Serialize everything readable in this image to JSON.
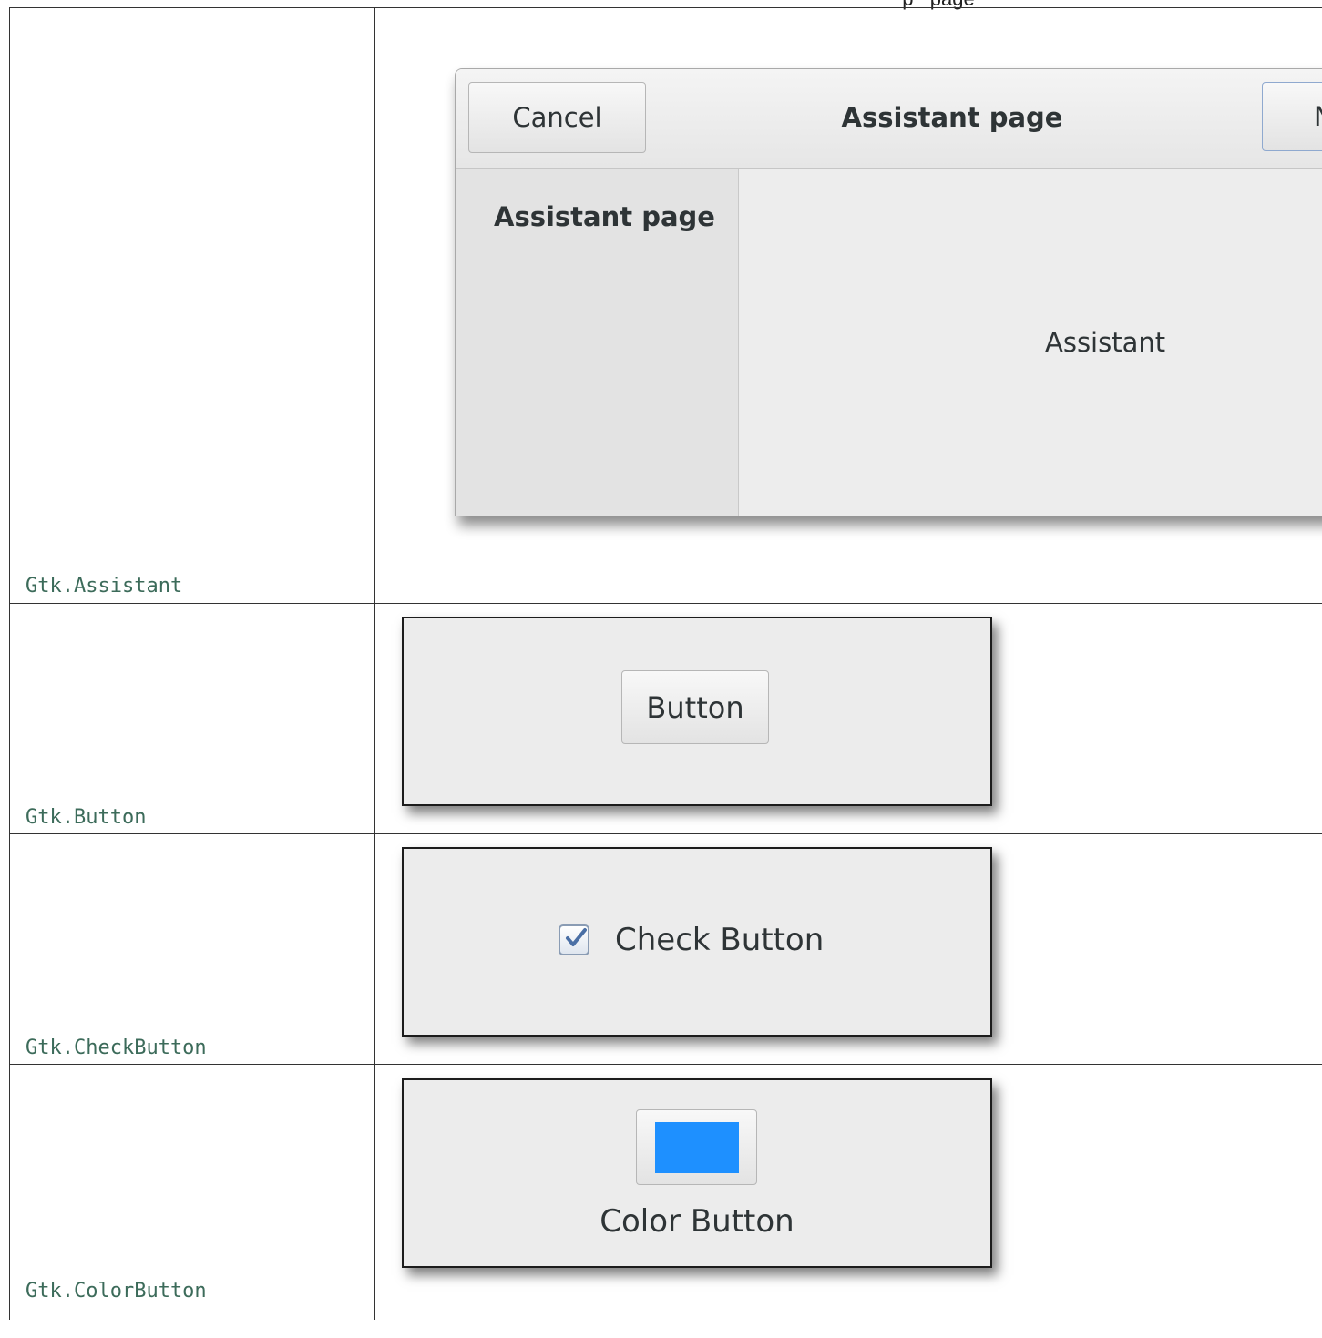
{
  "widgets": [
    {
      "label": "Gtk.Assistant"
    },
    {
      "label": "Gtk.Button"
    },
    {
      "label": "Gtk.CheckButton"
    },
    {
      "label": "Gtk.ColorButton"
    }
  ],
  "assistant": {
    "cancel_label": "Cancel",
    "title": "Assistant page",
    "next_label": "N",
    "sidebar_page": "Assistant page",
    "content_text": "Assistant"
  },
  "button_demo": {
    "label": "Button"
  },
  "check_demo": {
    "label": "Check Button",
    "checked": true
  },
  "color_demo": {
    "label": "Color Button",
    "color": "#1e90ff"
  }
}
